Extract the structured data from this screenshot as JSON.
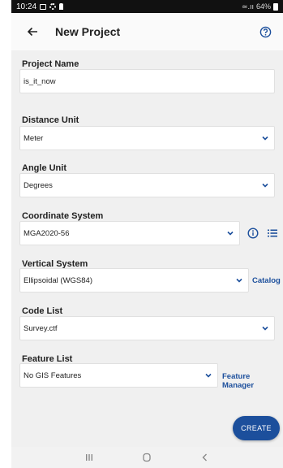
{
  "status_bar": {
    "time": "10:24",
    "signal": "≃.ıı",
    "battery": "64%"
  },
  "app_bar": {
    "title": "New Project",
    "back_icon": "arrow-left-icon",
    "help_icon": "help-circle-icon"
  },
  "form": {
    "project_name": {
      "label": "Project Name",
      "value": "is_it_now"
    },
    "distance_unit": {
      "label": "Distance Unit",
      "value": "Meter"
    },
    "angle_unit": {
      "label": "Angle Unit",
      "value": "Degrees"
    },
    "coordinate_system": {
      "label": "Coordinate System",
      "value": "MGA2020-56"
    },
    "vertical_system": {
      "label": "Vertical System",
      "value": "Ellipsoidal (WGS84)",
      "link": "Catalog"
    },
    "code_list": {
      "label": "Code List",
      "value": "Survey.ctf"
    },
    "feature_list": {
      "label": "Feature List",
      "value": "No GIS Features",
      "link": "Feature Manager"
    }
  },
  "create_button": "CREATE",
  "colors": {
    "accent": "#1c4f9c",
    "background": "#f0f0f0",
    "status_bar": "#111111"
  }
}
